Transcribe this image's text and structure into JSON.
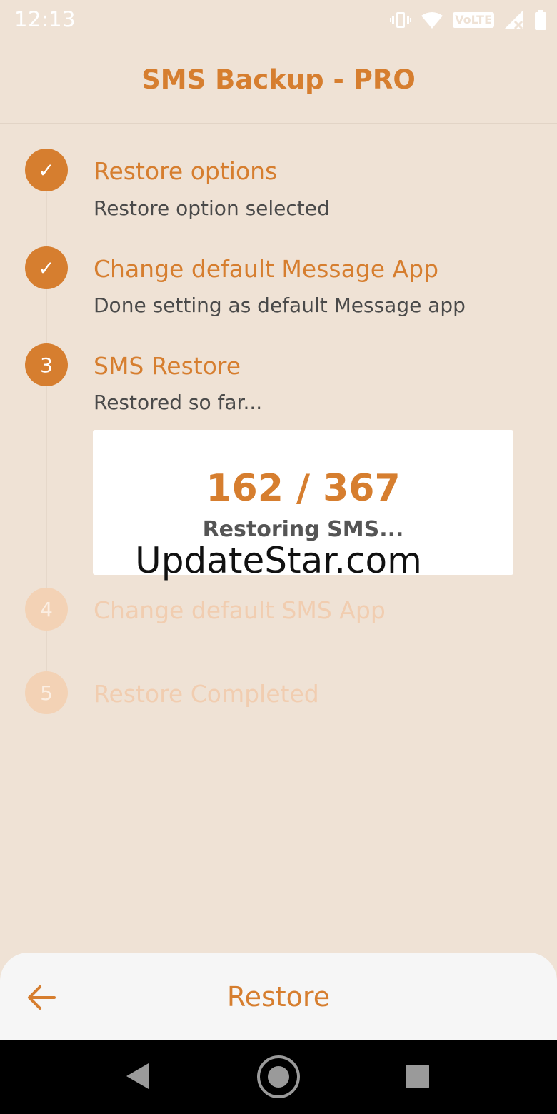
{
  "status_bar": {
    "time": "12:13",
    "volte_label": "VoLTE",
    "icons": [
      "vibrate-icon",
      "wifi-icon",
      "volte-icon",
      "signal-icon",
      "battery-icon"
    ]
  },
  "header": {
    "title": "SMS Backup - PRO"
  },
  "steps": [
    {
      "marker": "✓",
      "title": "Restore options",
      "subtitle": "Restore option selected",
      "state": "completed"
    },
    {
      "marker": "✓",
      "title": "Change default Message App",
      "subtitle": "Done setting as default Message app",
      "state": "completed"
    },
    {
      "marker": "3",
      "title": "SMS Restore",
      "subtitle": "Restored so far...",
      "state": "active"
    },
    {
      "marker": "4",
      "title": "Change default SMS App",
      "state": "pending"
    },
    {
      "marker": "5",
      "title": "Restore Completed",
      "state": "pending"
    }
  ],
  "progress": {
    "count": "162 / 367",
    "label": "Restoring SMS..."
  },
  "watermark": "UpdateStar.com",
  "bottom_bar": {
    "back_icon": "arrow-left-icon",
    "action_label": "Restore"
  },
  "navigation": {
    "icons": [
      "nav-back-icon",
      "nav-home-icon",
      "nav-recent-icon"
    ]
  },
  "colors": {
    "accent": "#d67e2f",
    "background": "#efe2d5",
    "inactive_accent": "#f3d2b5"
  }
}
